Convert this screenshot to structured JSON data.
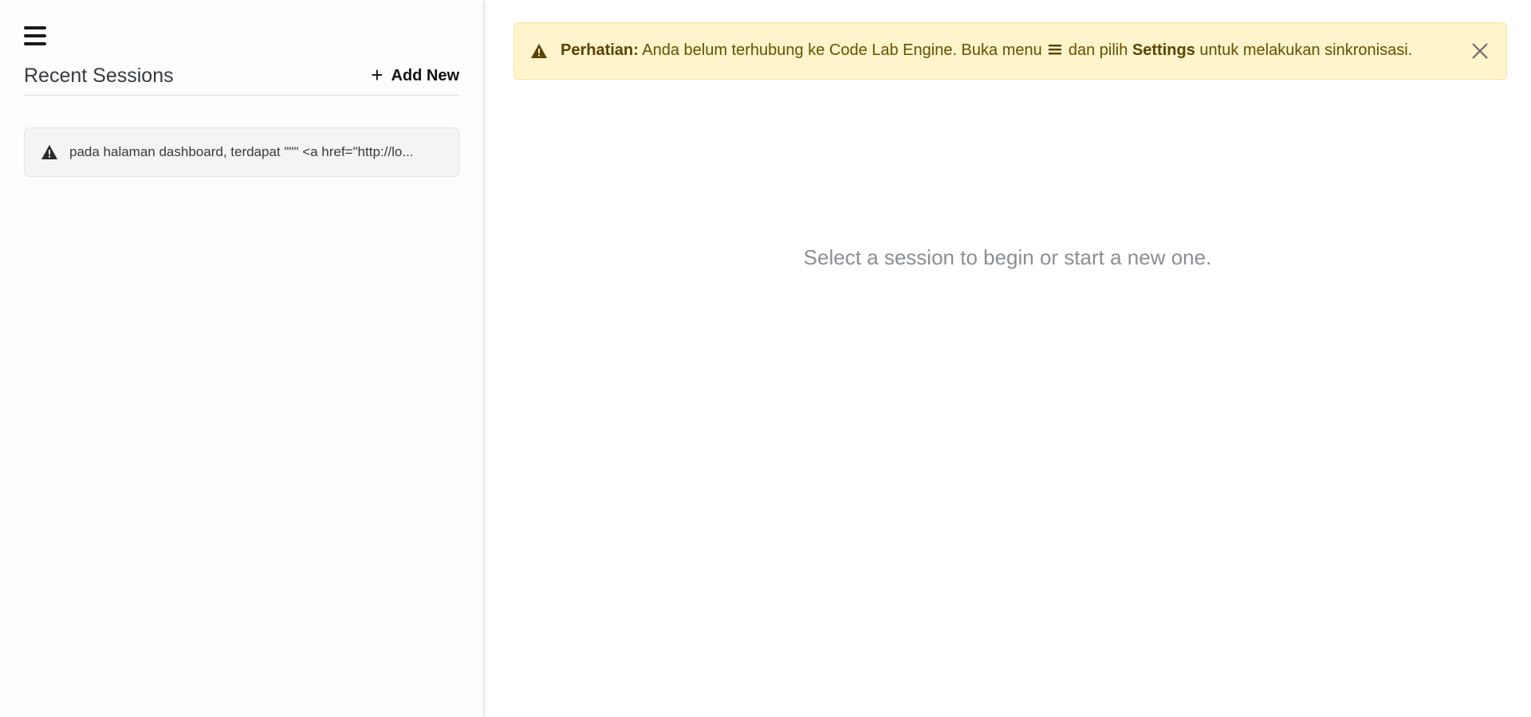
{
  "sidebar": {
    "title": "Recent Sessions",
    "add_new_label": "Add New",
    "sessions": [
      {
        "text": "pada halaman dashboard, terdapat \"\"\" <a href=\"http://lo..."
      }
    ]
  },
  "alert": {
    "prefix": "Perhatian:",
    "text_1": "Anda belum terhubung ke Code Lab Engine. Buka menu",
    "text_2": "dan pilih",
    "settings": "Settings",
    "text_3": "untuk melakukan sinkronisasi."
  },
  "main": {
    "empty_message": "Select a session to begin or start a new one."
  },
  "icons": {
    "menu": "hamburger-menu-icon",
    "plus": "plus-icon",
    "warning": "warning-triangle-icon",
    "close": "close-icon"
  },
  "colors": {
    "alert_bg": "#fff4cc",
    "alert_text": "#6a4e00",
    "sidebar_bg": "#fdfdfd"
  }
}
